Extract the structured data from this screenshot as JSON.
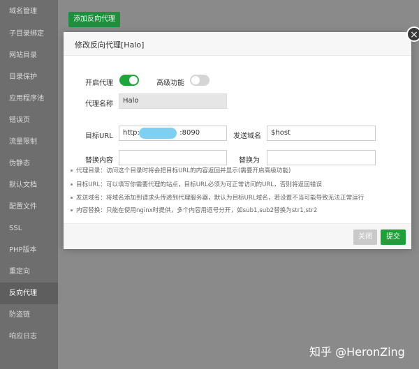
{
  "sidebar": {
    "items": [
      {
        "label": "域名管理"
      },
      {
        "label": "子目录绑定"
      },
      {
        "label": "网站目录"
      },
      {
        "label": "目录保护"
      },
      {
        "label": "应用程序池"
      },
      {
        "label": "错误页"
      },
      {
        "label": "流量限制"
      },
      {
        "label": "伪静态"
      },
      {
        "label": "默认文档"
      },
      {
        "label": "配置文件"
      },
      {
        "label": "SSL"
      },
      {
        "label": "PHP版本"
      },
      {
        "label": "重定向"
      },
      {
        "label": "反向代理"
      },
      {
        "label": "防盗链"
      },
      {
        "label": "响应日志"
      }
    ],
    "active": "反向代理"
  },
  "toolbar": {
    "add_label": "添加反向代理"
  },
  "modal": {
    "title": "修改反向代理[Halo]",
    "close_symbol": "×",
    "enable_label": "开启代理",
    "enable_on": true,
    "advanced_label": "高级功能",
    "advanced_on": false,
    "name_label": "代理名称",
    "name_value": "Halo",
    "target_label": "目标URL",
    "target_value_prefix": "http:/",
    "target_value_suffix": ":8090",
    "send_domain_label": "发送域名",
    "send_domain_value": "$host",
    "replace_content_label": "替换内容",
    "replace_content_value": "",
    "replace_with_label": "替换为",
    "replace_with_value": "",
    "notes": [
      "代理目录：访问这个目录时将会把目标URL的内容返回并显示(需要开启高级功能)",
      "目标URL：可以填写你需要代理的站点，目标URL必须为可正常访问的URL，否则将返回错误",
      "发送域名：将域名添加到请求头传递到代理服务器，默认为目标URL域名，若设置不当可能导致无法正常运行",
      "内容替换：只能在使用nginx时提供，多个内容用逗号分开，如sub1,sub2替换为str1,str2"
    ],
    "close_button": "关闭",
    "submit_button": "提交"
  },
  "watermark": "知乎 @HeronZing",
  "colors": {
    "accent": "#20a53a",
    "toggle_off": "#d5d5d5",
    "redaction": "#7ecff2"
  }
}
